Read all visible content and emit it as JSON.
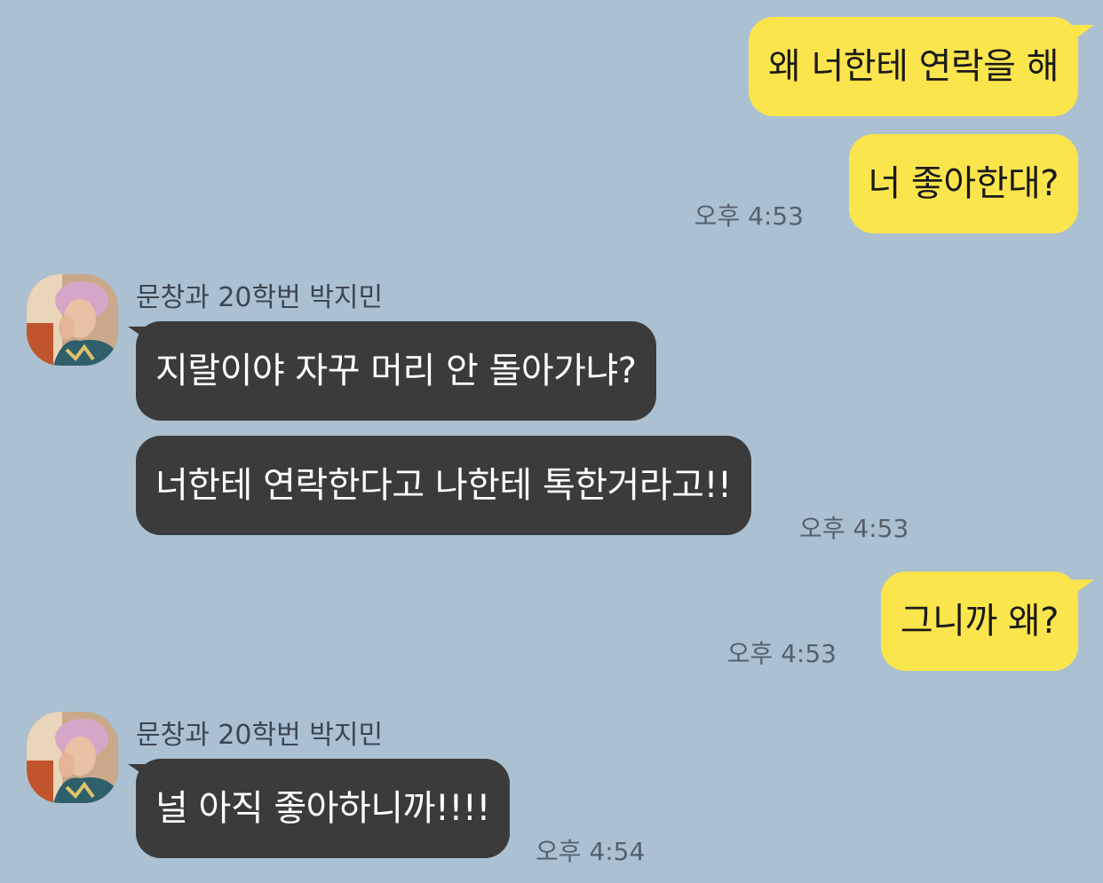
{
  "chat": {
    "messages": [
      {
        "from": "me",
        "text": "왜 너한테 연락을 해"
      },
      {
        "from": "me",
        "text": "너 좋아한대?",
        "time": "오후 4:53"
      },
      {
        "from": "them",
        "sender": "문창과 20학번 박지민",
        "text": "지랄이야 자꾸 머리 안 돌아가냐?"
      },
      {
        "from": "them",
        "text": "너한테 연락한다고 나한테 톡한거라고!!",
        "time": "오후 4:53"
      },
      {
        "from": "me",
        "text": "그니까 왜?",
        "time": "오후 4:53"
      },
      {
        "from": "them",
        "sender": "문창과 20학번 박지민",
        "text": "널 아직 좋아하니까!!!!",
        "time": "오후 4:54"
      }
    ]
  },
  "colors": {
    "background": "#abc1d1",
    "my_bubble": "#fbe54d",
    "their_bubble": "#3b3b3b",
    "time_text": "#56616b"
  },
  "icons": {
    "avatar": "profile-photo-avatar"
  }
}
